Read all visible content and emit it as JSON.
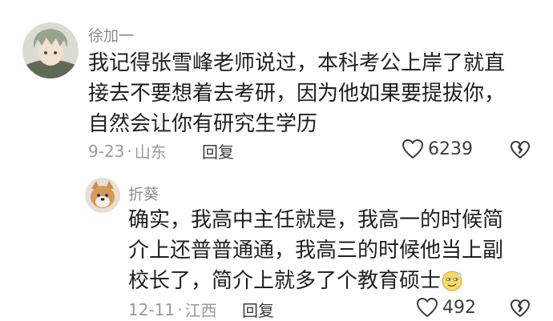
{
  "comments": [
    {
      "username": "徐加一",
      "text_lines": [
        "我记得张雪峰老师说过，本科考公上岸了就直",
        "接去不要想着去考研，因为他如果要提拔你，",
        "自然会让你有研究生学历"
      ],
      "date": "9-23",
      "location": "山东",
      "dot": "·",
      "reply_label": "回复",
      "likes": "6239",
      "avatar_icon": "anime-boy-avatar"
    },
    {
      "username": "折葵",
      "text_lines": [
        "确实，我高中主任就是，我高一的时候简",
        "介上还普普通通，我高三的时候他当上副",
        "校长了，简介上就多了个教育硕士"
      ],
      "date": "12-11",
      "location": "江西",
      "dot": "·",
      "reply_label": "回复",
      "likes": "492",
      "avatar_icon": "shiba-dog-avatar",
      "trailing_emoji": "smirk-emoji"
    }
  ],
  "colors": {
    "text": "#1f1f1f",
    "meta": "#9a9a9a",
    "username": "#8c8c8c"
  }
}
